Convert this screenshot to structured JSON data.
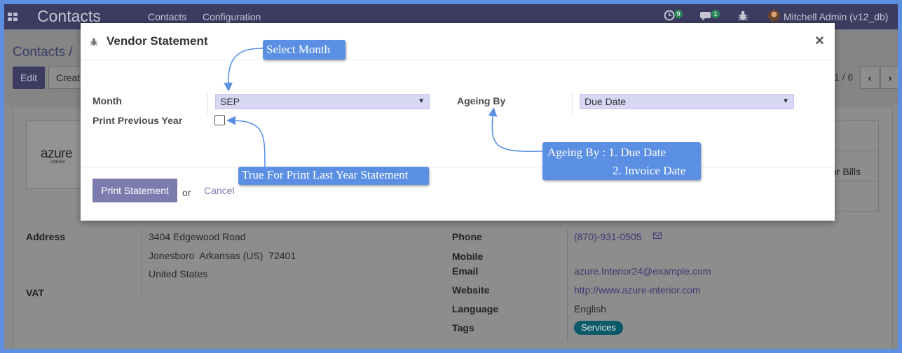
{
  "navbar": {
    "brand": "Contacts",
    "menu": [
      "Contacts",
      "Configuration"
    ],
    "activity_count": "9",
    "message_count": "1",
    "user": "Mitchell Admin (v12_db)"
  },
  "control_panel": {
    "breadcrumb": "Contacts /",
    "edit_label": "Edit",
    "create_label": "Create",
    "pager": "1 / 6"
  },
  "record": {
    "logo_main": "azure",
    "logo_sub": "interior",
    "stat_label": "or Bills",
    "address_label": "Address",
    "address_lines": [
      "3404 Edgewood Road",
      "Jonesboro  Arkansas (US)  72401",
      "United States"
    ],
    "vat_label": "VAT",
    "phone_label": "Phone",
    "phone": "(870)-931-0505",
    "mobile_label": "Mobile",
    "email_label": "Email",
    "email": "azure.Interior24@example.com",
    "website_label": "Website",
    "website": "http://www.azure-interior.com",
    "language_label": "Language",
    "language": "English",
    "tags_label": "Tags",
    "tag": "Services"
  },
  "modal": {
    "title": "Vendor Statement",
    "month_label": "Month",
    "month_value": "SEP",
    "print_prev_label": "Print Previous Year",
    "print_prev_checked": false,
    "ageing_label": "Ageing By",
    "ageing_value": "Due Date",
    "print_button": "Print Statement",
    "or_text": "or",
    "cancel_label": "Cancel"
  },
  "callouts": {
    "select_month": "Select Month",
    "print_last_year": "True For Print Last Year Statement",
    "ageing_line1": "Ageing By : 1. Due Date",
    "ageing_line2": "2. Invoice Date"
  },
  "colors": {
    "navbar": "#3c3b60",
    "primary": "#7c7bad",
    "select_bg": "#d8d7f4",
    "callout": "#5b8fe3",
    "tag": "#0b5a69"
  }
}
